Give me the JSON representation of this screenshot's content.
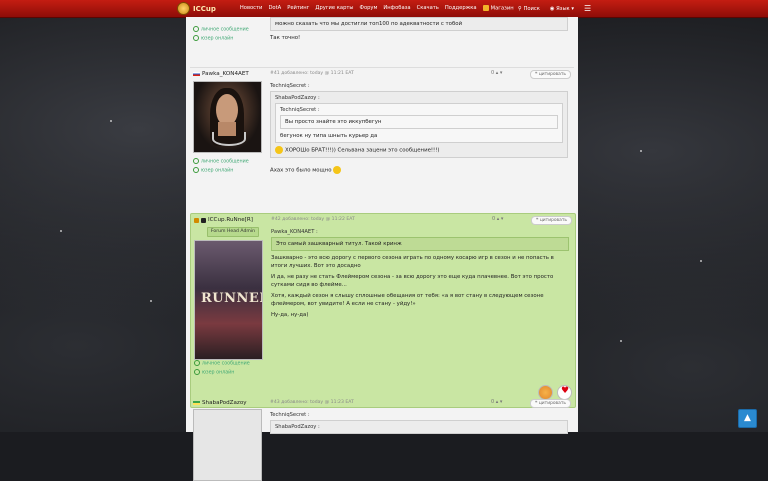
{
  "topbar": {
    "logo_text": "ICCup",
    "nav": [
      "Новости",
      "DotA",
      "Рейтинг",
      "Другие карты",
      "Форум",
      "Инфобаза",
      "Скачать",
      "Поддержка",
      "Магазин"
    ],
    "search": "Поиск",
    "language": "Язык",
    "menu_icon": "hamburger-icon"
  },
  "post1": {
    "links": [
      "личное сообщение",
      "юзер онлайн"
    ],
    "quote_tail": "можно сказать что мы достигли топ100 по адекватности с тобой",
    "reply": "Так точно!"
  },
  "post2": {
    "author": "Pawka_KON4AET",
    "meta": "#41 добавлено: today @ 11:21 EAT",
    "rating": "0",
    "quote_button": "цитировать",
    "links": [
      "личное сообщение",
      "юзер онлайн"
    ],
    "q_outer_name": "TechniqSecret :",
    "q_mid_name": "ShabaPodZazoy :",
    "q_inner_name": "TechniqSecret :",
    "q_inner_text": "Вы просто знайте это иккупбегун",
    "q_mid_text": "бегунок ну типа шныть курьер да",
    "q_outer_text": "ХОРОШо БРАТ!!!)) Сельвана зацени это сообщение!!!)",
    "reply": "Ахах это было мощно"
  },
  "post3": {
    "author": "ICCup.RuNne[R]",
    "role": "Forum Head Admin",
    "meta": "#42 добавлено: today @ 11:22 EAT",
    "rating": "0",
    "quote_button": "цитировать",
    "avatar_text": "RUNNER",
    "links": [
      "личное сообщение",
      "юзер онлайн"
    ],
    "q_name": "Pawka_KON4AET :",
    "q_text": "Это самый зашкварный титул. Такой кринж",
    "p1": "Зашкварно - это всю дорогу с первого сезона играть по одному косарю игр в сезон и не попасть в итоги лучших. Вот это досадно",
    "p2": "И да, не разу не стать Флеймером сезона - за всю дорогу это еще куда плачевнее. Вот это просто сутками сидя во флейме...",
    "p3": "Хотя, каждый сезон я слышу сплошные обещания от тебя: «а я вот стану в следующем сезоне флеймером, вот увидите! А если не стану - уйду!»",
    "p4": "Ну-да, ну-да)"
  },
  "post4": {
    "author": "ShabaPodZazoy",
    "meta": "#43 добавлено: today @ 11:23 EAT",
    "rating": "0",
    "quote_button": "цитировать",
    "q_name": "TechniqSecret :",
    "q_inner_name": "ShabaPodZazoy :"
  }
}
